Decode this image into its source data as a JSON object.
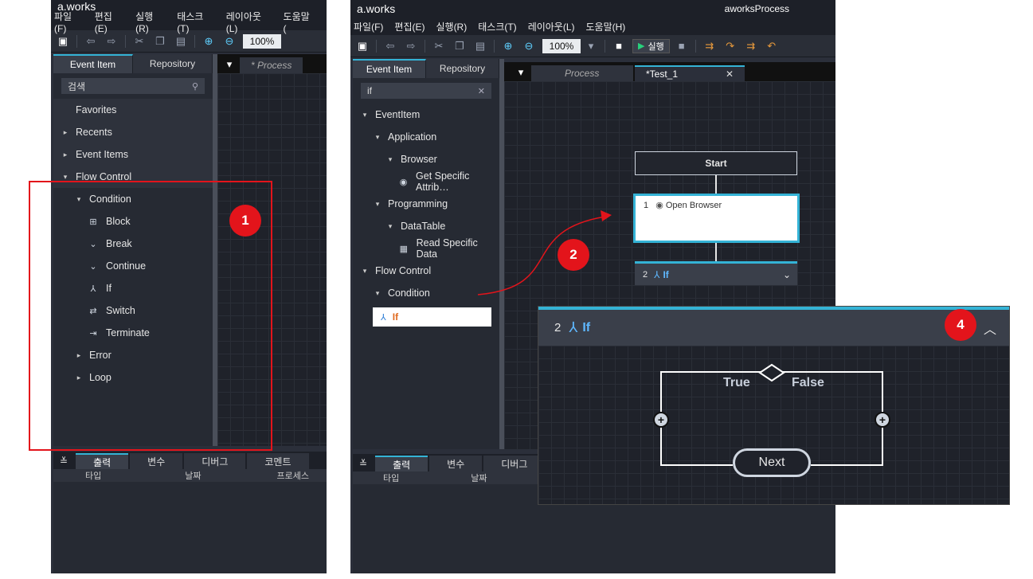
{
  "left_app": {
    "title": "a.works",
    "menu": [
      "파일(F)",
      "편집(E)",
      "실행(R)",
      "태스크(T)",
      "레이아웃(L)",
      "도움말("
    ],
    "zoom": "100%",
    "tabs": [
      "Event Item",
      "Repository"
    ],
    "search_placeholder": "검색",
    "tree": [
      {
        "label": "Favorites",
        "level": 0,
        "arrow": ""
      },
      {
        "label": "Recents",
        "level": 0,
        "arrow": "▸"
      },
      {
        "label": "Event Items",
        "level": 0,
        "arrow": "▸"
      },
      {
        "label": "Flow Control",
        "level": 0,
        "arrow": "▾"
      },
      {
        "label": "Condition",
        "level": 1,
        "arrow": "▾"
      },
      {
        "label": "Block",
        "level": 2,
        "icon": "⊞"
      },
      {
        "label": "Break",
        "level": 2,
        "icon": "⌄"
      },
      {
        "label": "Continue",
        "level": 2,
        "icon": "⌄"
      },
      {
        "label": "If",
        "level": 2,
        "icon": "⅄"
      },
      {
        "label": "Switch",
        "level": 2,
        "icon": "⇄"
      },
      {
        "label": "Terminate",
        "level": 2,
        "icon": "⇥"
      },
      {
        "label": "Error",
        "level": 1,
        "arrow": "▸"
      },
      {
        "label": "Loop",
        "level": 1,
        "arrow": "▸"
      }
    ],
    "doc_tab": "* Process",
    "output_tabs": [
      "출력",
      "변수",
      "디버그",
      "코멘트"
    ],
    "output_cols": [
      "타입",
      "날짜",
      "프로세스"
    ]
  },
  "right_app": {
    "title": "a.works",
    "window_title": "aworksProcess",
    "menu": [
      "파일(F)",
      "편집(E)",
      "실행(R)",
      "태스크(T)",
      "레이아웃(L)",
      "도움말(H)"
    ],
    "zoom": "100%",
    "run_label": "실행",
    "tabs": [
      "Event Item",
      "Repository"
    ],
    "search_value": "if",
    "tree": [
      {
        "label": "EventItem",
        "level": 0,
        "arrow": "▾"
      },
      {
        "label": "Application",
        "level": 1,
        "arrow": "▾"
      },
      {
        "label": "Browser",
        "level": 2,
        "arrow": "▾"
      },
      {
        "label": "Get Specific Attrib…",
        "level": 3,
        "icon": "◉"
      },
      {
        "label": "Programming",
        "level": 1,
        "arrow": "▾"
      },
      {
        "label": "DataTable",
        "level": 2,
        "arrow": "▾"
      },
      {
        "label": "Read Specific Data",
        "level": 3,
        "icon": "▦"
      },
      {
        "label": "Flow Control",
        "level": 0,
        "arrow": "▾"
      },
      {
        "label": "Condition",
        "level": 1,
        "arrow": "▾"
      }
    ],
    "selected_item": "If",
    "doc_tabs": [
      "Process",
      "*Test_1"
    ],
    "output_tabs": [
      "출력",
      "변수",
      "디버그"
    ],
    "output_cols": [
      "타입",
      "날짜"
    ],
    "flow": {
      "start": "Start",
      "open_browser_num": "1",
      "open_browser": "Open Browser",
      "if_num": "2",
      "if_label": "If"
    }
  },
  "popup": {
    "num": "2",
    "label": "If",
    "true_label": "True",
    "false_label": "False",
    "next_label": "Next"
  },
  "badges": [
    "1",
    "2",
    "4"
  ],
  "colors": {
    "accent": "#34b3d6",
    "badge": "#e3141b"
  }
}
